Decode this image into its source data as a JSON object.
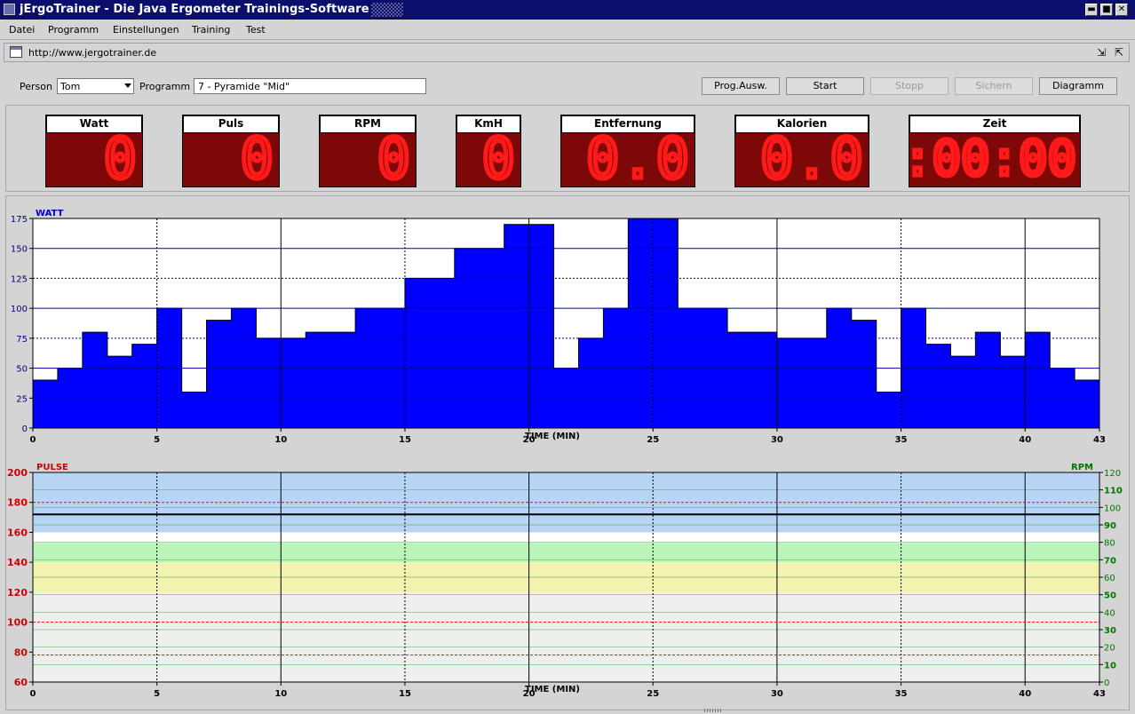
{
  "window": {
    "title": "jErgoTrainer - Die Java Ergometer Trainings-Software",
    "minimize_symbol": "▬",
    "maximize_symbol": "■",
    "close_symbol": "✕"
  },
  "menu": [
    "Datei",
    "Programm",
    "Einstellungen",
    "Training",
    "Test"
  ],
  "url": "http://www.jergotrainer.de",
  "controls": {
    "person_label": "Person",
    "person_value": "Tom",
    "program_label": "Programm",
    "program_value": "7 - Pyramide \"Mid\"",
    "buttons": [
      {
        "label": "Prog.Ausw.",
        "enabled": true
      },
      {
        "label": "Start",
        "enabled": true
      },
      {
        "label": "Stopp",
        "enabled": false
      },
      {
        "label": "Sichern",
        "enabled": false
      },
      {
        "label": "Diagramm",
        "enabled": true
      }
    ]
  },
  "displays": [
    {
      "label": "Watt",
      "value": "0"
    },
    {
      "label": "Puls",
      "value": "0"
    },
    {
      "label": "RPM",
      "value": "0"
    },
    {
      "label": "KmH",
      "value": "0"
    },
    {
      "label": "Entfernung",
      "value": "0.0"
    },
    {
      "label": "Kalorien",
      "value": "0.0"
    },
    {
      "label": "Zeit",
      "value": "0:00:00"
    }
  ],
  "colors": {
    "watt_fill": "#0000ff",
    "display_bg": "#7c0808",
    "display_digit": "#ff1a1a",
    "pulse_axis": "#cc0000",
    "rpm_axis": "#007700"
  },
  "chart_data": [
    {
      "type": "area",
      "ylabel": "WATT",
      "xlabel": "TIME (MIN)",
      "xlim": [
        0,
        43
      ],
      "ylim": [
        0,
        175
      ],
      "x_ticks": [
        0,
        5,
        10,
        15,
        20,
        25,
        30,
        35,
        40,
        43
      ],
      "y_ticks": [
        0,
        25,
        50,
        75,
        100,
        125,
        150,
        175
      ],
      "grid": true,
      "step": true,
      "series": [
        {
          "x": [
            0,
            1,
            2,
            3,
            4,
            5,
            6,
            7,
            8,
            9,
            10,
            11,
            12,
            13,
            14,
            15,
            16,
            17,
            18,
            19,
            20,
            21,
            22,
            23,
            24,
            25,
            26,
            27,
            28,
            29,
            30,
            31,
            32,
            33,
            34,
            35,
            36,
            37,
            38,
            39,
            40,
            41,
            42
          ],
          "values": [
            40,
            50,
            80,
            60,
            70,
            100,
            30,
            90,
            100,
            75,
            75,
            80,
            80,
            100,
            100,
            125,
            125,
            150,
            150,
            170,
            170,
            50,
            75,
            100,
            175,
            175,
            100,
            100,
            80,
            80,
            75,
            75,
            100,
            90,
            30,
            100,
            70,
            60,
            80,
            60,
            80,
            50,
            40
          ]
        }
      ]
    },
    {
      "type": "line",
      "ylabel": "PULSE",
      "y2label": "RPM",
      "xlabel": "TIME (MIN)",
      "xlim": [
        0,
        43
      ],
      "ylim": [
        60,
        200
      ],
      "y2lim": [
        0,
        120
      ],
      "x_ticks": [
        0,
        5,
        10,
        15,
        20,
        25,
        30,
        35,
        40,
        43
      ],
      "y_ticks": [
        60,
        80,
        100,
        120,
        140,
        160,
        180,
        200
      ],
      "y2_ticks": [
        0,
        10,
        20,
        30,
        40,
        50,
        60,
        70,
        80,
        90,
        100,
        110,
        120
      ],
      "grid": true,
      "zones": [
        {
          "from": 160,
          "to": 200,
          "color": "#b8d4f4"
        },
        {
          "from": 140,
          "to": 153,
          "color": "#b9f5b9"
        },
        {
          "from": 120,
          "to": 140,
          "color": "#f3f3b0"
        },
        {
          "from": 60,
          "to": 120,
          "color": "#efefef"
        }
      ],
      "reference_lines": [
        {
          "y": 172,
          "color": "#000000"
        },
        {
          "y": 180,
          "color": "#ff0000"
        },
        {
          "y": 100,
          "color": "#ff0000"
        },
        {
          "y": 78,
          "color": "#ff0000"
        }
      ],
      "series": []
    }
  ]
}
